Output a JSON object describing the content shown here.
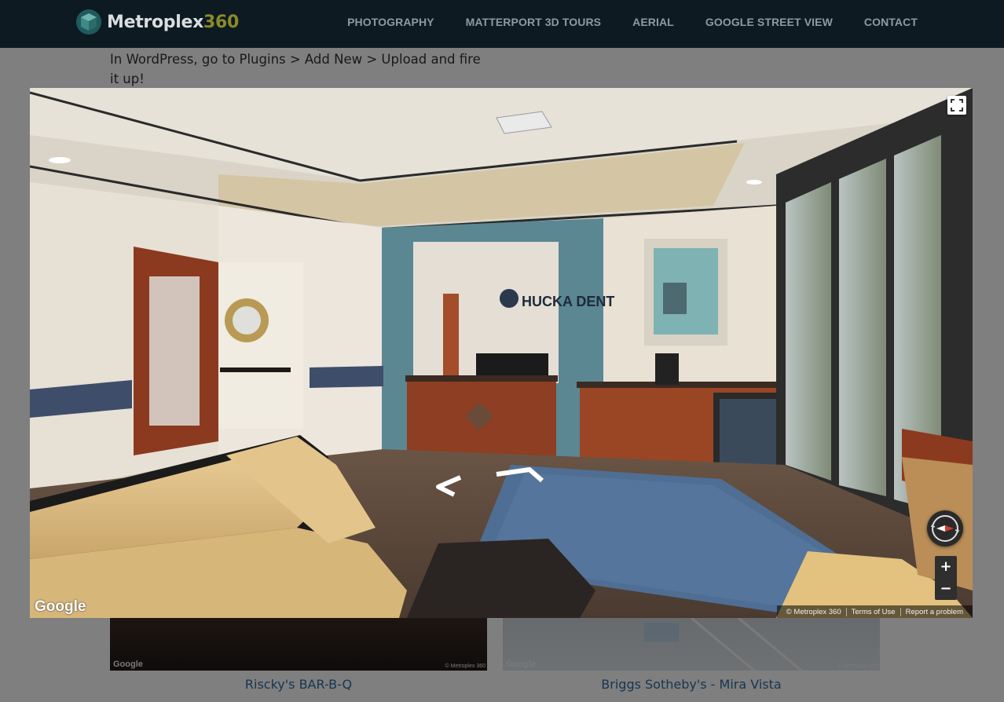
{
  "header": {
    "logo_text": "Metroplex",
    "logo_accent": "360",
    "nav": [
      "PHOTOGRAPHY",
      "MATTERPORT 3D TOURS",
      "AERIAL",
      "GOOGLE STREET VIEW",
      "CONTACT"
    ]
  },
  "page": {
    "intro_text": "In WordPress, go to Plugins > Add New > Upload and fire it up!",
    "thumbnails": [
      {
        "label": "Riscky's BAR-B-Q",
        "google": "Google",
        "copyright": "© Metroplex 360"
      },
      {
        "label": "Briggs Sotheby's - Mira Vista",
        "google": "Google",
        "copyright": "© Metroplex 360"
      }
    ]
  },
  "viewer": {
    "sign_text": "HUCKA DENT",
    "google_watermark": "Google",
    "zoom_in": "+",
    "zoom_out": "−",
    "attribution": {
      "copyright": "© Metroplex 360",
      "terms": "Terms of Use",
      "report": "Report a problem"
    }
  },
  "colors": {
    "header_bg": "#0e1a22",
    "nav_text": "#8f999f",
    "link": "#2e6da4",
    "logo_accent": "#8a8a2a"
  }
}
